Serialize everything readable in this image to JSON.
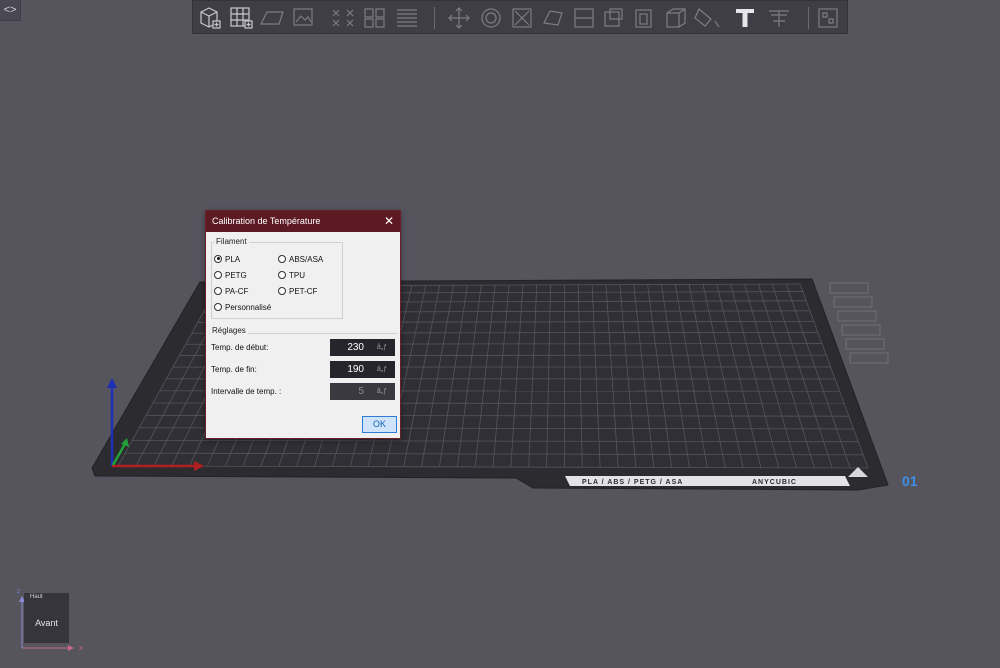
{
  "colors": {
    "background": "#56555e",
    "toolbar_bg": "#3f3e47",
    "dialog_title_bg": "#5c1a22",
    "ok_border": "#2d7bd4",
    "bed_color": "#2b2b30",
    "bed_number": "#3d8fe8"
  },
  "sidebar_toggle": {
    "icon": "collapse-arrows-icon",
    "label": "<>"
  },
  "toolbar": {
    "icons": [
      "add-model-icon",
      "grid-arrange-icon",
      "add-plate-icon",
      "picture-icon",
      "split-parts-icon",
      "split-objects-icon",
      "layers-icon",
      "move-icon",
      "rotate-icon",
      "scale-icon",
      "lay-flat-icon",
      "cut-icon",
      "support-paint-icon",
      "hollow-icon",
      "measure-icon",
      "paint-icon",
      "text-icon",
      "mold-icon",
      "settings-icon"
    ]
  },
  "bed": {
    "label": "PLA / ABS / PETG / ASA",
    "brand": "ANYCUBIC",
    "number": "01"
  },
  "dialog": {
    "title": "Calibration de Température",
    "close": "✕",
    "filament_group": "Filament",
    "options": [
      {
        "label": "PLA",
        "checked": true
      },
      {
        "label": "ABS/ASA",
        "checked": false
      },
      {
        "label": "PETG",
        "checked": false
      },
      {
        "label": "TPU",
        "checked": false
      },
      {
        "label": "PA-CF",
        "checked": false
      },
      {
        "label": "PET-CF",
        "checked": false
      },
      {
        "label": "Personnalisé",
        "checked": false
      }
    ],
    "settings_group": "Réglages",
    "settings": [
      {
        "label": "Temp. de début:",
        "value": "230",
        "unit": "â„ƒ",
        "enabled": true
      },
      {
        "label": "Temp. de fin:",
        "value": "190",
        "unit": "â„ƒ",
        "enabled": true
      },
      {
        "label": "Intervalle de temp. :",
        "value": "5",
        "unit": "â„ƒ",
        "enabled": false
      }
    ],
    "ok": "OK"
  },
  "viewcube": {
    "face": "Avant",
    "top_face": "Haut",
    "axis_x": "x",
    "axis_z": "z"
  }
}
